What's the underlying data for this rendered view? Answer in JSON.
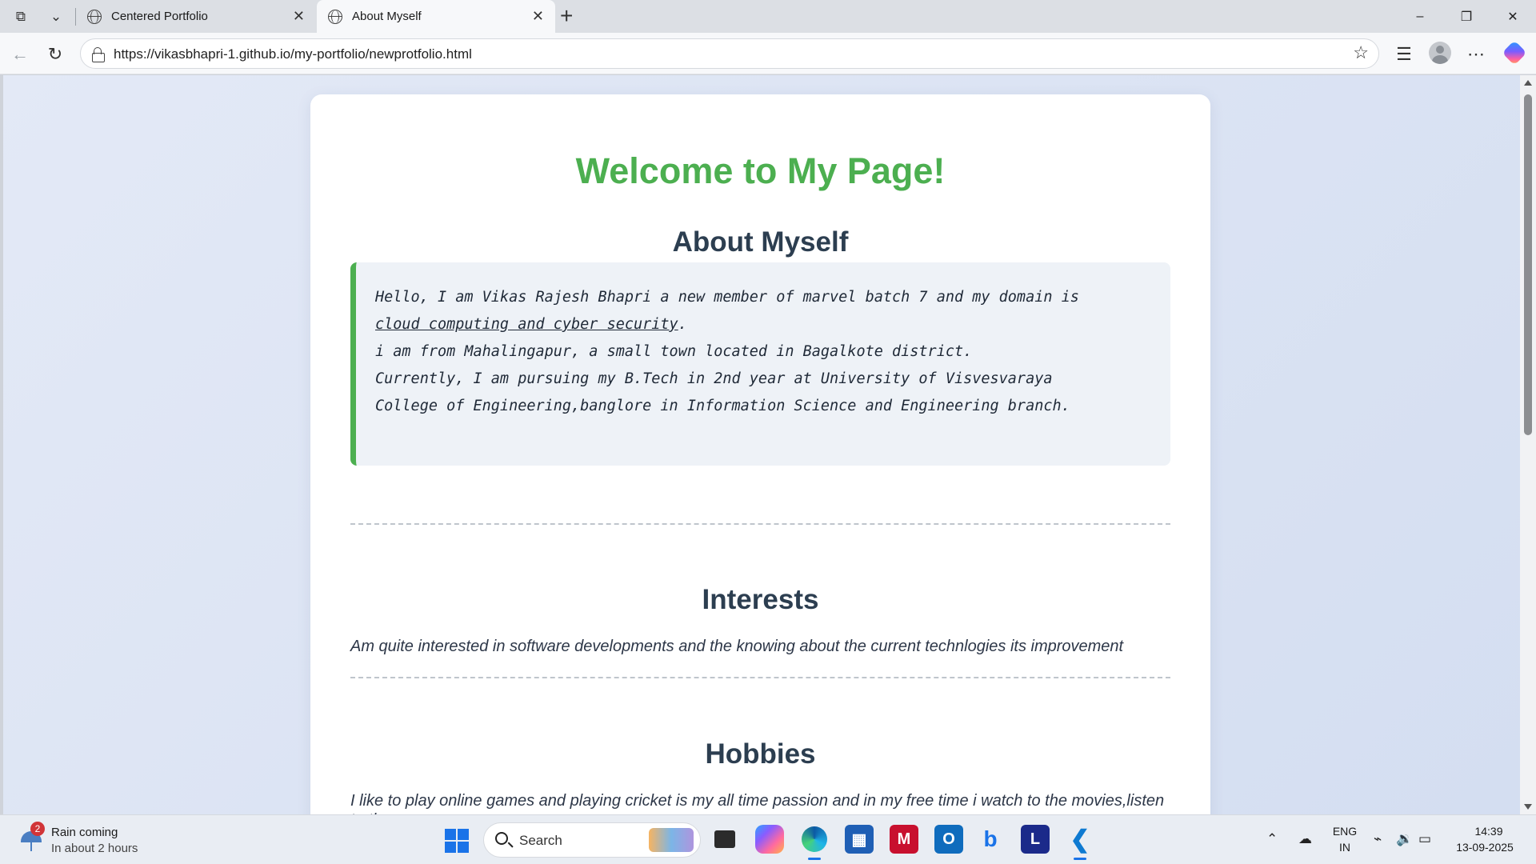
{
  "browser": {
    "tabs": [
      {
        "title": "Centered Portfolio",
        "active": false
      },
      {
        "title": "About Myself",
        "active": true
      }
    ],
    "new_tab_label": "+",
    "url": "https://vikasbhapri-1.github.io/my-portfolio/newprotfolio.html"
  },
  "page": {
    "welcome_heading": "Welcome to My Page!",
    "about_heading": "About Myself",
    "about": {
      "line1": "Hello, I am Vikas Rajesh Bhapri a new member of marvel batch 7 and my domain is",
      "domain_link": "cloud computing and cyber security",
      "line2_suffix": ".",
      "line3": "i am from Mahalingapur, a small town located in Bagalkote district.",
      "line4": "Currently, I am pursuing my B.Tech in 2nd year at University of Visvesvaraya",
      "line5": "College of Engineering,banglore in Information Science and Engineering branch."
    },
    "interests_heading": "Interests",
    "interests_text": "Am quite interested in software developments and the knowing about the current technlogies its improvement",
    "hobbies_heading": "Hobbies",
    "hobbies_text": "I like to play online games and playing cricket is my all time passion and in my free time i watch to the movies,listen to the songs"
  },
  "colors": {
    "welcome_green": "#4caf50",
    "heading_navy": "#2c3e50",
    "accent_border": "#4caf50"
  },
  "taskbar": {
    "weather": {
      "badge": "2",
      "title": "Rain coming",
      "subtitle": "In about 2 hours"
    },
    "search_placeholder": "Search",
    "apps": [
      "copilot",
      "file-explorer",
      "edge",
      "microsoft-store",
      "mcafee",
      "outlook",
      "bing",
      "l-app",
      "vscode"
    ],
    "tray": {
      "lang_top": "ENG",
      "lang_bottom": "IN",
      "time": "14:39",
      "date": "13-09-2025"
    }
  }
}
